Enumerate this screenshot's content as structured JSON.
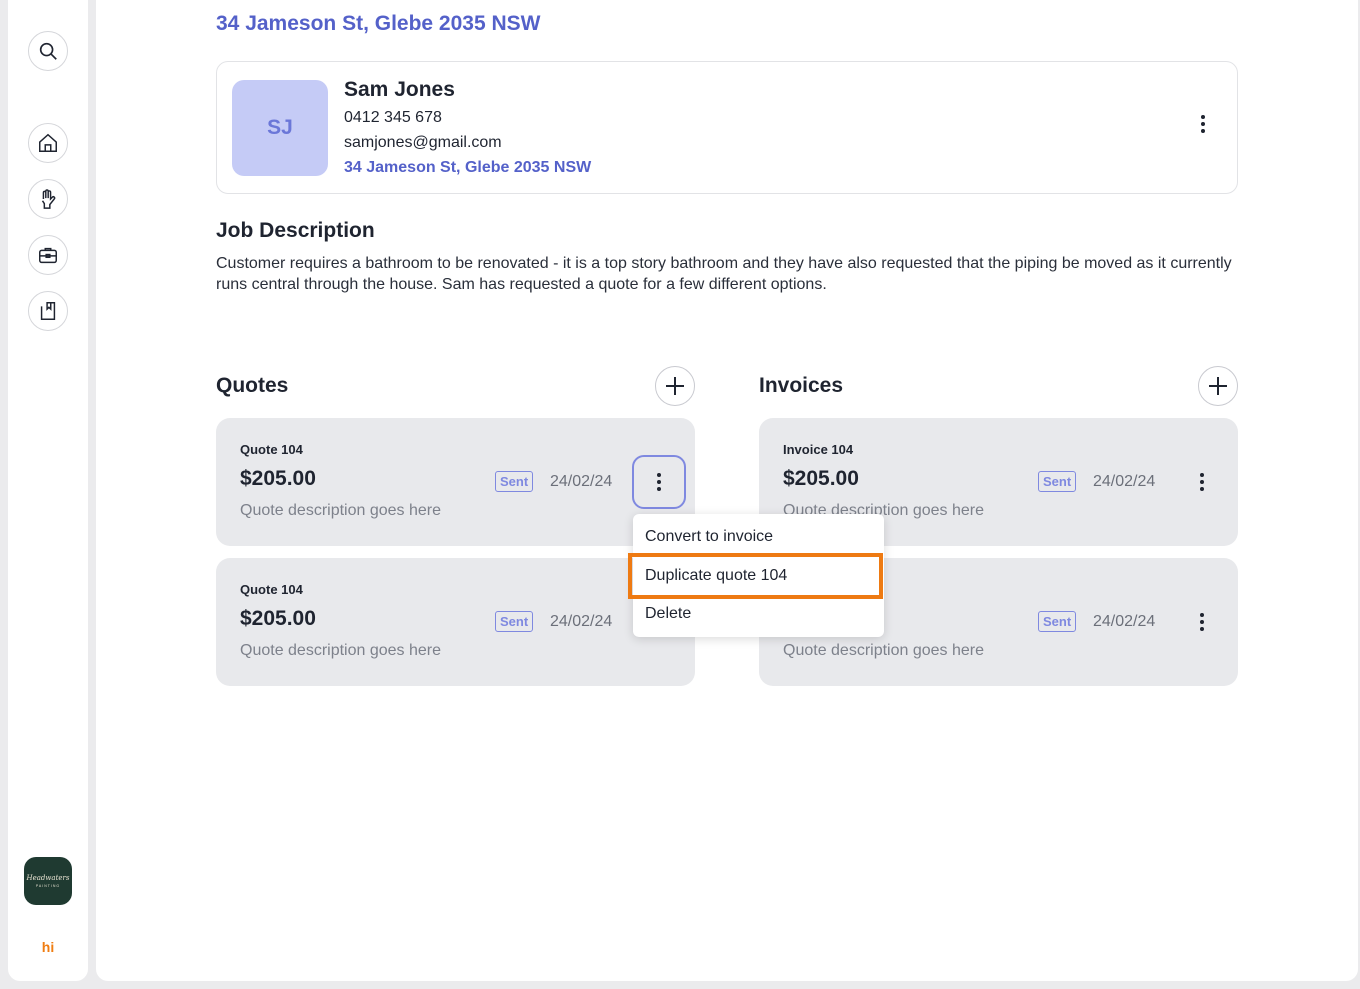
{
  "sidebar": {
    "icons": [
      "search-icon",
      "home-icon",
      "hand-icon",
      "briefcase-icon",
      "bookmark-icon"
    ],
    "brand": {
      "line1": "Headwaters",
      "line2": "PAINTING"
    },
    "footer_logo": "hi"
  },
  "header": {
    "address": "34 Jameson St, Glebe 2035 NSW"
  },
  "contact": {
    "initials": "SJ",
    "name": "Sam Jones",
    "phone": "0412 345 678",
    "email": "samjones@gmail.com",
    "address": "34 Jameson St, Glebe 2035 NSW"
  },
  "job": {
    "title": "Job Description",
    "description": "Customer requires a bathroom to be renovated - it is a top story bathroom and they have also requested that the piping be moved as it currently runs central through the house.  Sam has requested a quote for a few different options."
  },
  "quotes": {
    "title": "Quotes",
    "items": [
      {
        "title": "Quote 104",
        "amount": "$205.00",
        "status": "Sent",
        "date": "24/02/24",
        "description": "Quote description goes here"
      },
      {
        "title": "Quote 104",
        "amount": "$205.00",
        "status": "Sent",
        "date": "24/02/24",
        "description": "Quote description goes here"
      }
    ]
  },
  "invoices": {
    "title": "Invoices",
    "items": [
      {
        "title": "Invoice 104",
        "amount": "$205.00",
        "status": "Sent",
        "date": "24/02/24",
        "description": "Quote description goes here"
      },
      {
        "title": "",
        "amount": "",
        "status": "Sent",
        "date": "24/02/24",
        "description": "Quote description goes here"
      }
    ]
  },
  "menu": {
    "items": [
      "Convert to invoice",
      "Duplicate quote 104",
      "Delete"
    ]
  },
  "colors": {
    "accent": "#5461c9",
    "highlight": "#ee7a12",
    "card_bg": "#e8e9ec",
    "brand_bg": "#1f3a31"
  }
}
